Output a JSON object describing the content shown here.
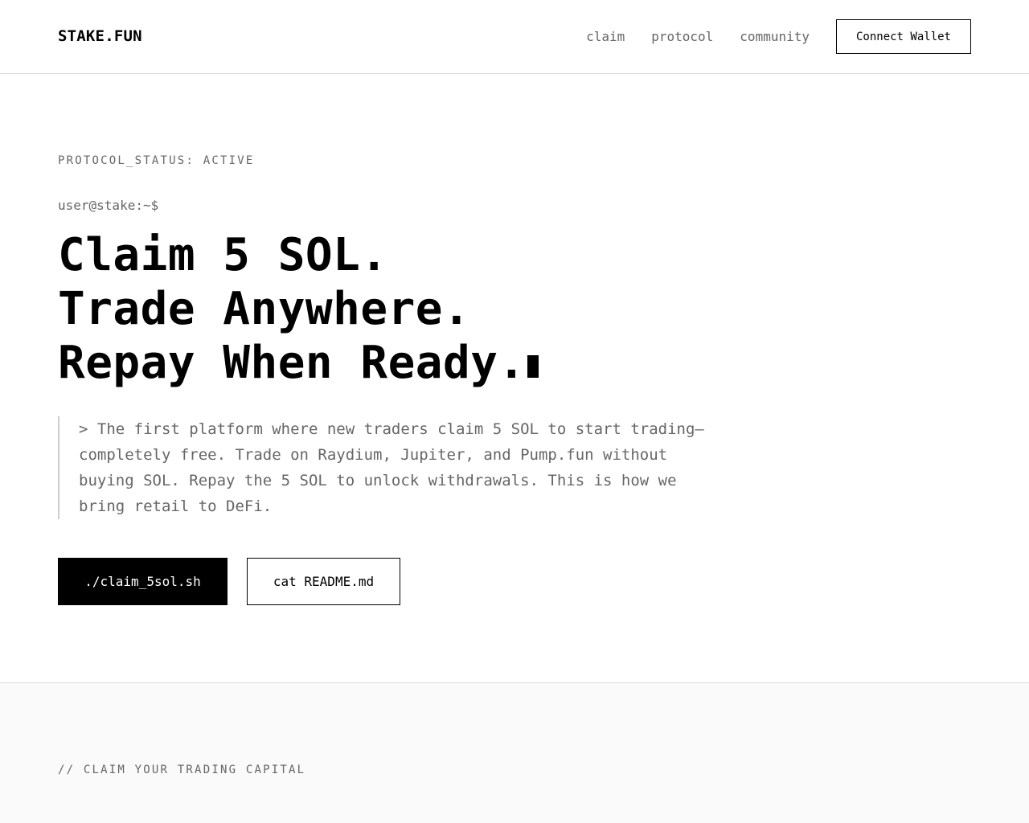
{
  "header": {
    "logo": "STAKE.FUN",
    "nav": [
      {
        "label": "claim"
      },
      {
        "label": "protocol"
      },
      {
        "label": "community"
      }
    ],
    "connect_label": "Connect Wallet"
  },
  "hero": {
    "status": "PROTOCOL_STATUS: ACTIVE",
    "prompt": "user@stake:~$",
    "headline": [
      "Claim 5 SOL.",
      "Trade Anywhere.",
      "Repay When Ready."
    ],
    "description": "> The first platform where new traders claim 5 SOL to start trading—completely free. Trade on Raydium, Jupiter, and Pump.fun without buying SOL. Repay the 5 SOL to unlock withdrawals. This is how we bring retail to DeFi.",
    "primary_cta": "./claim_5sol.sh",
    "secondary_cta": "cat README.md"
  },
  "section2": {
    "label": "// CLAIM YOUR TRADING CAPITAL"
  },
  "colors": {
    "text": "#000000",
    "muted": "#666666",
    "border": "#dcdcdc",
    "section_bg": "#fafafa"
  }
}
